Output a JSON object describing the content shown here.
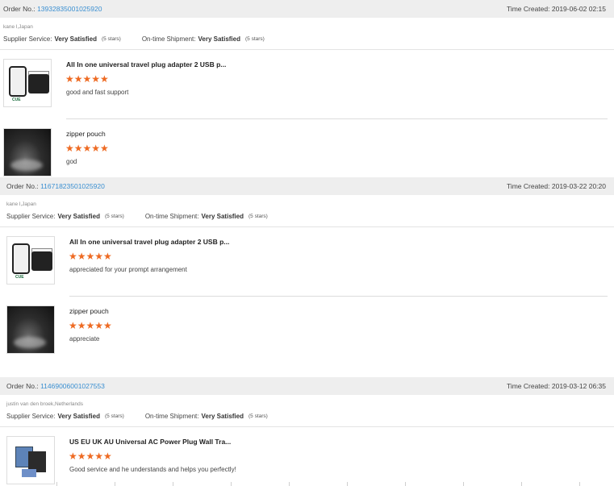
{
  "labels": {
    "order_no": "Order No.:",
    "time_created": "Time Created:",
    "supplier_service": "Supplier Service:",
    "ontime_shipment": "On-time Shipment:"
  },
  "star_glyphs": "★★★★★",
  "orders": [
    {
      "order_no": "13932835001025920",
      "time_created": "2019-06-02 02:15",
      "buyer": "kane l,Japan",
      "supplier_rating": "Very Satisfied",
      "supplier_stars": "(5 stars)",
      "shipment_rating": "Very Satisfied",
      "shipment_stars": "(5 stars)",
      "items": [
        {
          "title": "All In one universal travel plug adapter 2 USB p...",
          "stars": 5,
          "comment": "good and fast support",
          "image_icon": "travel-adapter-photo"
        },
        {
          "title": "zipper pouch",
          "stars": 5,
          "comment": "god",
          "image_icon": "zipper-pouch-photo"
        }
      ]
    },
    {
      "order_no": "11671823501025920",
      "time_created": "2019-03-22 20:20",
      "buyer": "kane l,Japan",
      "supplier_rating": "Very Satisfied",
      "supplier_stars": "(5 stars)",
      "shipment_rating": "Very Satisfied",
      "shipment_stars": "(5 stars)",
      "items": [
        {
          "title": "All In one universal travel plug adapter 2 USB p...",
          "stars": 5,
          "comment": "appreciated for your prompt arrangement",
          "image_icon": "travel-adapter-photo"
        },
        {
          "title": "zipper pouch",
          "stars": 5,
          "comment": "appreciate",
          "image_icon": "zipper-pouch-photo"
        }
      ]
    },
    {
      "order_no": "11469006001027553",
      "time_created": "2019-03-12 06:35",
      "buyer": "justin van den broek,Netherlands",
      "supplier_rating": "Very Satisfied",
      "supplier_stars": "(5 stars)",
      "shipment_rating": "Very Satisfied",
      "shipment_stars": "(5 stars)",
      "items": [
        {
          "title": "US EU UK AU Universal AC Power Plug Wall Tra...",
          "stars": 5,
          "comment": "Good service and he understands and helps you perfectly!",
          "image_icon": "power-plug-photo"
        }
      ]
    }
  ],
  "colors": {
    "link": "#3a8fd1",
    "star": "#ee6a22",
    "header_bg": "#eeeeee"
  }
}
